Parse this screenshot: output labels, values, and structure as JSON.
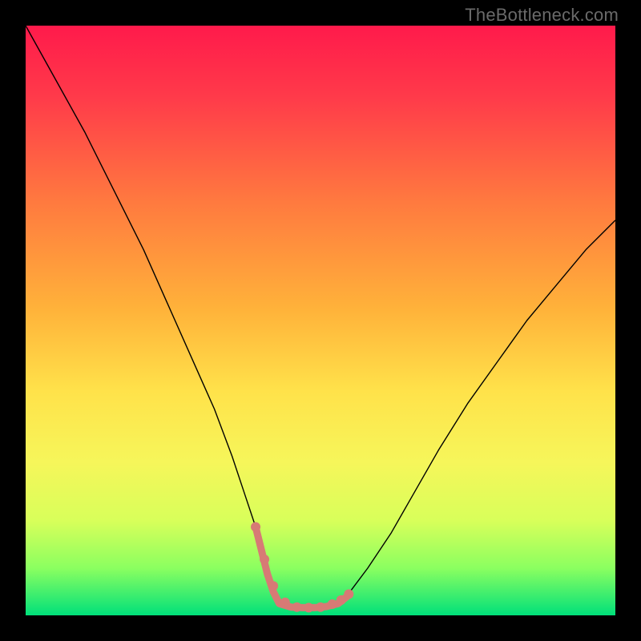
{
  "watermark": "TheBottleneck.com",
  "chart_data": {
    "type": "line",
    "title": "",
    "xlabel": "",
    "ylabel": "",
    "xlim": [
      0,
      100
    ],
    "ylim": [
      0,
      100
    ],
    "grid": false,
    "legend": false,
    "background_gradient_stops": [
      {
        "offset": 0.0,
        "color": "#ff1a4b"
      },
      {
        "offset": 0.12,
        "color": "#ff3a4a"
      },
      {
        "offset": 0.3,
        "color": "#ff7a3f"
      },
      {
        "offset": 0.48,
        "color": "#ffb23a"
      },
      {
        "offset": 0.62,
        "color": "#ffe24a"
      },
      {
        "offset": 0.74,
        "color": "#f6f65a"
      },
      {
        "offset": 0.84,
        "color": "#d8ff5a"
      },
      {
        "offset": 0.92,
        "color": "#8bff60"
      },
      {
        "offset": 1.0,
        "color": "#00e07a"
      }
    ],
    "series": [
      {
        "name": "bottleneck-curve",
        "stroke": "#000000",
        "stroke_width": 1.4,
        "x": [
          0,
          5,
          10,
          15,
          20,
          24,
          28,
          32,
          35,
          37,
          39,
          40,
          41,
          42,
          43,
          45,
          47,
          48,
          49,
          51,
          53,
          55,
          58,
          62,
          66,
          70,
          75,
          80,
          85,
          90,
          95,
          100
        ],
        "y": [
          100,
          91,
          82,
          72,
          62,
          53,
          44,
          35,
          27,
          21,
          15,
          11,
          7,
          4,
          2,
          1.4,
          1.3,
          1.3,
          1.3,
          1.5,
          2,
          4,
          8,
          14,
          21,
          28,
          36,
          43,
          50,
          56,
          62,
          67
        ]
      },
      {
        "name": "highlight-bottom",
        "stroke": "#d77a75",
        "stroke_width": 9,
        "linecap": "round",
        "x": [
          39,
          40,
          41,
          42,
          43,
          45,
          47,
          48,
          49,
          51,
          53,
          54.5
        ],
        "y": [
          15,
          11,
          7,
          4,
          2,
          1.4,
          1.3,
          1.3,
          1.3,
          1.5,
          2,
          3.2
        ]
      }
    ],
    "markers": {
      "name": "highlight-dots",
      "fill": "#d77a75",
      "radius": 6,
      "x": [
        39,
        40.5,
        42,
        44,
        46,
        48,
        50,
        52,
        53.5,
        54.8
      ],
      "y": [
        15,
        9.5,
        5,
        2.2,
        1.4,
        1.3,
        1.4,
        1.9,
        2.6,
        3.6
      ]
    }
  }
}
